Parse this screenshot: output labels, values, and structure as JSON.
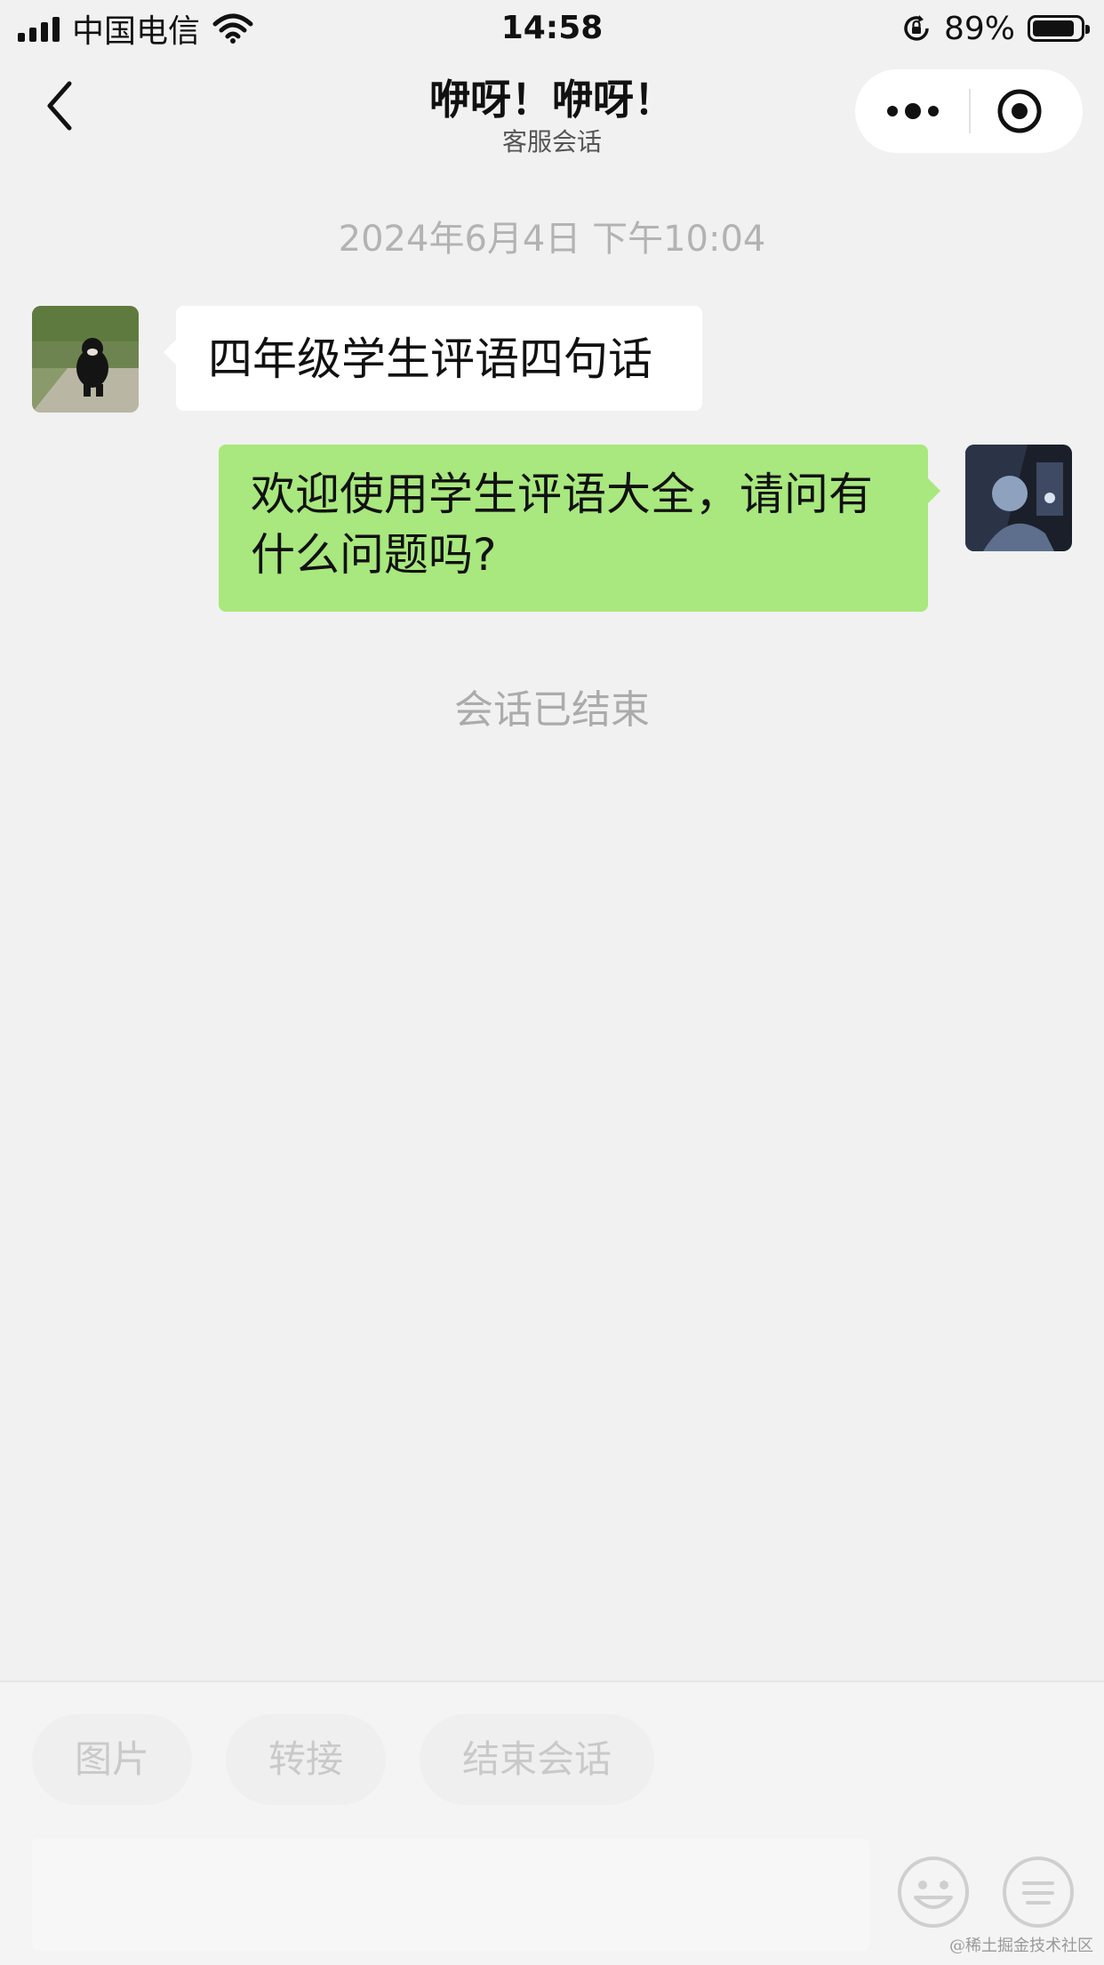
{
  "status_bar": {
    "carrier": "中国电信",
    "time": "14:58",
    "battery_pct": "89%",
    "battery_level": 0.89
  },
  "nav": {
    "title": "咿呀！咿呀！",
    "subtitle": "客服会话"
  },
  "chat": {
    "timestamp": "2024年6月4日 下午10:04",
    "messages": [
      {
        "side": "left",
        "text": "四年级学生评语四句话"
      },
      {
        "side": "right",
        "text": "欢迎使用学生评语大全，请问有什么问题吗?"
      }
    ],
    "ended_notice": "会话已结束"
  },
  "quick_actions": [
    "图片",
    "转接",
    "结束会话"
  ],
  "watermark": "@稀土掘金技术社区",
  "colors": {
    "background": "#f1f1f1",
    "outgoing_bubble": "#a8e87e",
    "incoming_bubble": "#ffffff"
  }
}
